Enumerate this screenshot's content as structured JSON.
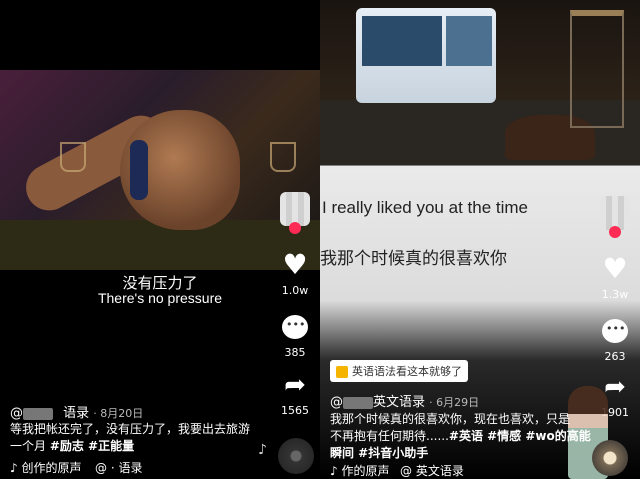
{
  "left": {
    "subtitle_cn": "没有压力了",
    "subtitle_en": "There's no pressure",
    "likes": "1.0w",
    "comments": "385",
    "shares": "1565",
    "author_suffix": "语录",
    "date": "· 8月20日",
    "desc_line1": "等我把帐还完了，没有压力了，我要出去旅游",
    "desc_line2_pre": "一个月 ",
    "tags": "#励志 #正能量",
    "music_left": "♪ 创作的原声",
    "music_right": "@     · 语录"
  },
  "right": {
    "subtitle_en": "I really liked you at the time",
    "subtitle_cn": "我那个时候真的很喜欢你",
    "likes": "1.3w",
    "comments": "263",
    "shares": "1901",
    "promo": "英语语法看这本就够了",
    "author_suffix": "英文语录",
    "date": "· 6月29日",
    "desc_line1": "我那个时候真的很喜欢你，现在也喜欢，只是",
    "desc_line2_pre": "不再抱有任何期待......",
    "desc_line2_tags": "#英语 #情感 #wo的高能",
    "desc_line3": "瞬间 #抖音小助手",
    "music_left": "♪ 作的原声",
    "music_right": "@     英文语录"
  },
  "colors": {
    "accent": "#fe2c55",
    "text": "#ffffff",
    "promo_icon": "#f5b400"
  },
  "icons": [
    "heart-icon",
    "comment-icon",
    "share-icon",
    "music-note-icon",
    "music-disc-icon",
    "avatar-icon"
  ]
}
